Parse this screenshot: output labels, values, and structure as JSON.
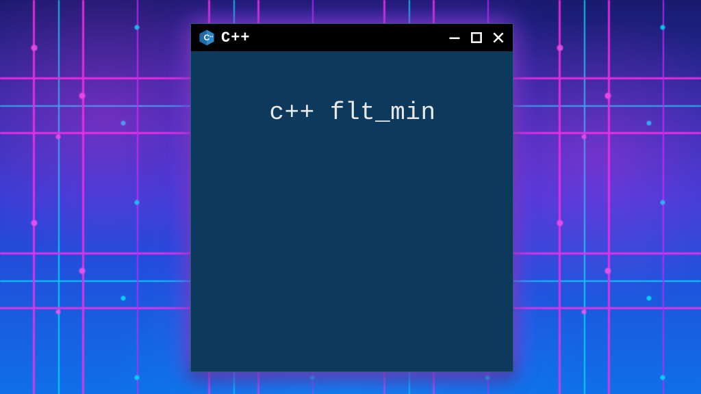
{
  "window": {
    "title": "C++",
    "icon_name": "cpp-logo",
    "controls": {
      "minimize_label": "Minimize",
      "maximize_label": "Maximize",
      "close_label": "Close"
    }
  },
  "terminal": {
    "content": "c++ flt_min"
  },
  "colors": {
    "window_body": "#0d3a5c",
    "titlebar": "#000000",
    "text": "#e8e8e8",
    "glow": "#b450ff"
  }
}
